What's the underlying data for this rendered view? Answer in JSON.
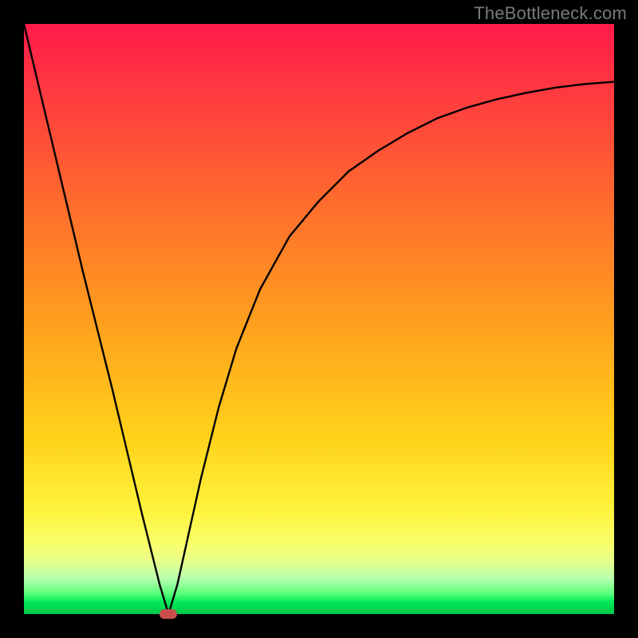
{
  "watermark": {
    "text": "TheBottleneck.com"
  },
  "chart_data": {
    "type": "line",
    "title": "",
    "xlabel": "",
    "ylabel": "",
    "xlim": [
      0,
      100
    ],
    "ylim": [
      0,
      100
    ],
    "grid": false,
    "legend": false,
    "background_gradient": {
      "direction": "vertical",
      "stops": [
        {
          "pos": 0,
          "color": "#ff1a4a"
        },
        {
          "pos": 30,
          "color": "#ff6b2d"
        },
        {
          "pos": 50,
          "color": "#ff9e1e"
        },
        {
          "pos": 70,
          "color": "#ffd21a"
        },
        {
          "pos": 88,
          "color": "#f9ff6a"
        },
        {
          "pos": 96,
          "color": "#5bff7a"
        },
        {
          "pos": 100,
          "color": "#00c84a"
        }
      ]
    },
    "series": [
      {
        "name": "bottleneck-curve",
        "color": "#000000",
        "x": [
          0,
          5,
          10,
          15,
          20,
          23,
          24.5,
          26,
          28,
          30,
          33,
          36,
          40,
          45,
          50,
          55,
          60,
          65,
          70,
          75,
          80,
          85,
          90,
          95,
          100
        ],
        "y": [
          100,
          79,
          58,
          38,
          17,
          5,
          0,
          5,
          14,
          23,
          35,
          45,
          55,
          64,
          70,
          75,
          78.5,
          81.5,
          84,
          85.8,
          87.2,
          88.3,
          89.2,
          89.8,
          90.2
        ]
      }
    ],
    "marker": {
      "name": "optimal-point",
      "shape": "pill",
      "color": "#c94f4f",
      "x": 24.5,
      "y": 0
    }
  }
}
